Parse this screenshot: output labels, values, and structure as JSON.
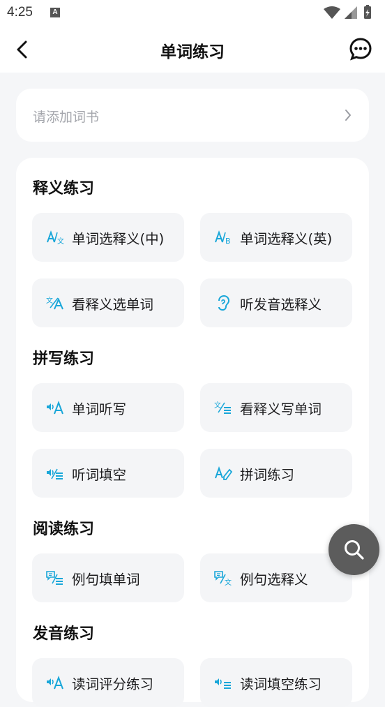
{
  "status_bar": {
    "time": "4:25",
    "notification_icon": "A"
  },
  "nav": {
    "title": "单词练习",
    "back_icon": "chevron-left-icon",
    "message_icon": "chat-bubble-icon"
  },
  "add_book": {
    "placeholder": "请添加词书"
  },
  "sections": [
    {
      "title": "释义练习",
      "tiles": [
        {
          "label": "单词选释义(中)",
          "icon": "word-to-chinese-icon"
        },
        {
          "label": "单词选释义(英)",
          "icon": "word-to-english-icon"
        },
        {
          "label": "看释义选单词",
          "icon": "meaning-to-word-icon"
        },
        {
          "label": "听发音选释义",
          "icon": "ear-icon"
        }
      ]
    },
    {
      "title": "拼写练习",
      "tiles": [
        {
          "label": "单词听写",
          "icon": "dictation-icon"
        },
        {
          "label": "看释义写单词",
          "icon": "meaning-write-icon"
        },
        {
          "label": "听词填空",
          "icon": "listen-fill-icon"
        },
        {
          "label": "拼词练习",
          "icon": "spell-pen-icon"
        }
      ]
    },
    {
      "title": "阅读练习",
      "tiles": [
        {
          "label": "例句填单词",
          "icon": "sentence-fill-icon"
        },
        {
          "label": "例句选释义",
          "icon": "sentence-meaning-icon"
        }
      ]
    },
    {
      "title": "发音练习",
      "tiles": [
        {
          "label": "读词评分练习",
          "icon": "speak-score-icon"
        },
        {
          "label": "读词填空练习",
          "icon": "speak-fill-icon"
        }
      ]
    }
  ],
  "colors": {
    "accent": "#1aa7d9",
    "tile_bg": "#f4f5f7",
    "page_bg": "#f5f6f8",
    "fab_bg": "#5c5c5c"
  },
  "fab": {
    "icon": "search-icon"
  }
}
